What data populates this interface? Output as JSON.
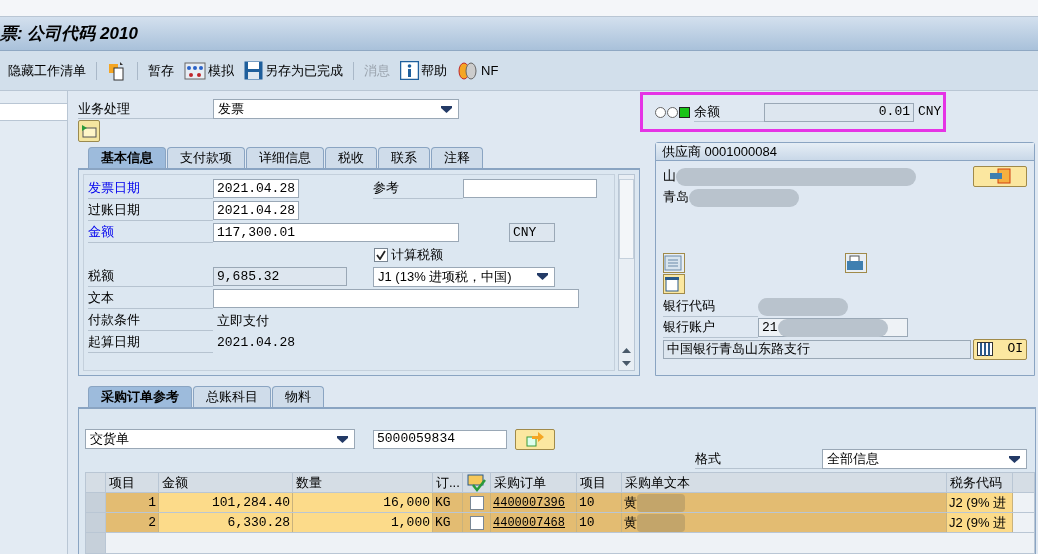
{
  "window": {
    "title": "票: 公司代码 2010"
  },
  "toolbar": [
    {
      "kind": "text",
      "label": "隐藏工作清单",
      "disabled": false
    },
    {
      "kind": "separator"
    },
    {
      "kind": "icon",
      "disabled": false
    },
    {
      "kind": "separator"
    },
    {
      "kind": "text",
      "label": "暂存",
      "disabled": false
    },
    {
      "kind": "icon_text",
      "label": "模拟",
      "disabled": false
    },
    {
      "kind": "icon_text",
      "label": "另存为已完成",
      "disabled": false
    },
    {
      "kind": "separator"
    },
    {
      "kind": "text",
      "label": "消息",
      "disabled": true
    },
    {
      "kind": "icon_text",
      "label": "帮助",
      "disabled": false
    },
    {
      "kind": "icon_text",
      "label": "NF",
      "disabled": false
    }
  ],
  "transaction": {
    "label": "业务处理",
    "value": "发票"
  },
  "balance": {
    "ok": true,
    "label": "余额",
    "value": "0.01",
    "currency": "CNY"
  },
  "tabs": [
    {
      "label": "基本信息",
      "selected": true
    },
    {
      "label": "支付款项",
      "selected": false
    },
    {
      "label": "详细信息",
      "selected": false
    },
    {
      "label": "税收",
      "selected": false
    },
    {
      "label": "联系",
      "selected": false
    },
    {
      "label": "注释",
      "selected": false
    }
  ],
  "basic": {
    "invoice_date": {
      "label": "发票日期",
      "value": "2021.04.28",
      "highlighted": true
    },
    "reference": {
      "label": "参考"
    },
    "posting_date": {
      "label": "过账日期",
      "value": "2021.04.28",
      "highlighted": false
    },
    "amount": {
      "label": "金额",
      "value": "117,300.01",
      "currency": "CNY",
      "highlighted": true
    },
    "calculate_tax": {
      "label": "计算税额",
      "checked": true
    },
    "tax_amount": {
      "label": "税额",
      "value": "9,685.32",
      "highlighted": false
    },
    "tax_code": {
      "value": "J1 (13% 进项税，中国)"
    },
    "text": {
      "label": "文本",
      "highlighted": false
    },
    "payment_terms": {
      "label": "付款条件",
      "value": "立即支付"
    },
    "baseline_date": {
      "label": "起算日期",
      "value": "2021.04.28"
    }
  },
  "vendor": {
    "title": "供应商 0001000084",
    "name": "山",
    "city": "青岛",
    "bank_code": {
      "label": "银行代码"
    },
    "bank_account": {
      "label": "银行账户",
      "value": "21"
    },
    "bank_name": "中国银行青岛山东路支行",
    "oi_button": "OI"
  },
  "ref_tabs": [
    {
      "label": "采购订单参考",
      "selected": true
    },
    {
      "label": "总账科目",
      "selected": false
    },
    {
      "label": "物料",
      "selected": false
    }
  ],
  "reference_doc": {
    "type": "交货单",
    "number": "5000059834"
  },
  "layout": {
    "label": "格式",
    "value": "全部信息"
  },
  "table": {
    "columns": [
      "项目",
      "金额",
      "数量",
      "订...",
      "采购订单",
      "项目",
      "采购单文本",
      "税务代码"
    ],
    "rows": [
      {
        "item": "1",
        "amount": "101,284.40",
        "quantity": "16,000",
        "unit": "KG",
        "checked": false,
        "po": "4400007396",
        "po_item": "10",
        "text": "黄",
        "tax_code": "J2 (9% 进"
      },
      {
        "item": "2",
        "amount": "6,330.28",
        "quantity": "1,000",
        "unit": "KG",
        "checked": false,
        "po": "4400007468",
        "po_item": "10",
        "text": "黄",
        "tax_code": "J2 (9% 进"
      }
    ]
  }
}
